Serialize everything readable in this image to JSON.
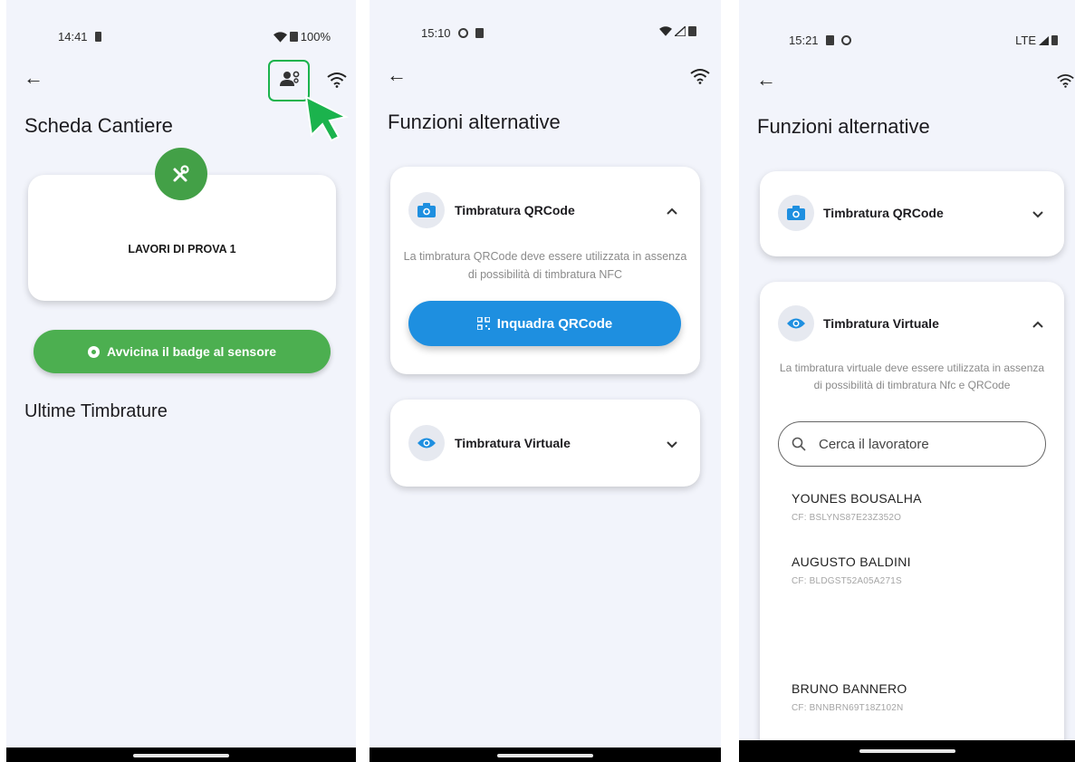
{
  "screen1": {
    "status": {
      "time": "14:41",
      "battery": "100%"
    },
    "title": "Scheda Cantiere",
    "project_name": "LAVORI DI PROVA 1",
    "nfc_button": "Avvicina il badge al sensore",
    "recent_title": "Ultime Timbrature",
    "icons": [
      "back-arrow-icon",
      "people-settings-icon",
      "wifi-icon",
      "tools-icon",
      "pointer-cursor-icon"
    ],
    "accent_color": "#43a047",
    "highlight_color": "#1bb34d"
  },
  "screen2": {
    "status": {
      "time": "15:10"
    },
    "title": "Funzioni alternative",
    "qr_section": {
      "label": "Timbratura QRCode",
      "description": "La timbratura QRCode deve essere utilizzata in assenza di possibilità di timbratura NFC",
      "button": "Inquadra QRCode",
      "expanded": true
    },
    "virtual_section": {
      "label": "Timbratura Virtuale",
      "expanded": false
    },
    "accent_color": "#1e8fe0"
  },
  "screen3": {
    "status": {
      "time": "15:21",
      "network": "LTE"
    },
    "title": "Funzioni alternative",
    "qr_section": {
      "label": "Timbratura QRCode",
      "expanded": false
    },
    "virtual_section": {
      "label": "Timbratura Virtuale",
      "description": "La timbratura virtuale deve essere utilizzata in assenza di possibilità di timbratura Nfc e QRCode",
      "expanded": true
    },
    "search": {
      "placeholder": "Cerca il lavoratore"
    },
    "workers": [
      {
        "name": "YOUNES BOUSALHA",
        "cf": "CF: BSLYNS87E23Z352O"
      },
      {
        "name": "AUGUSTO BALDINI",
        "cf": "CF: BLDGST52A05A271S"
      },
      {
        "name": "BRUNO BANNERO",
        "cf": "CF: BNNBRN69T18Z102N"
      }
    ]
  }
}
